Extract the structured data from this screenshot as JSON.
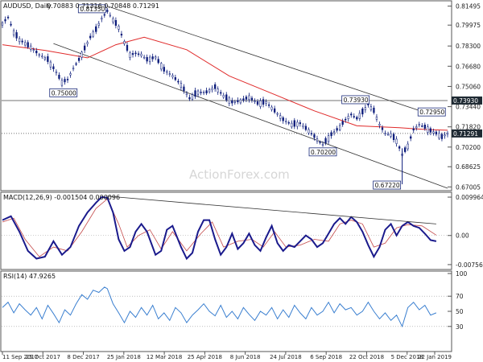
{
  "chart_data": [
    {
      "type": "candlestick",
      "panel": "price",
      "title": "AUDUSD, Daily",
      "ohlc_text": "0.70883 0.71316 0.70848 0.71291",
      "y_ticks": [
        0.81495,
        0.79975,
        0.783,
        0.7668,
        0.7506,
        0.7344,
        0.7182,
        0.702,
        0.68625,
        0.67005
      ],
      "ylim": [
        0.669,
        0.816
      ],
      "x_ticks": [
        "11 Sep 2017",
        "25 Oct 2017",
        "8 Dec 2017",
        "25 Jan 2018",
        "12 Mar 2018",
        "25 Apr 2018",
        "8 Jun 2018",
        "24 Jul 2018",
        "6 Sep 2018",
        "22 Oct 2018",
        "5 Dec 2018",
        "22 Jan 2019"
      ],
      "close_series": {
        "x_unit": "trading-day index, 0 = 11 Sep 2017",
        "points": [
          [
            0,
            0.801
          ],
          [
            4,
            0.806
          ],
          [
            8,
            0.794
          ],
          [
            12,
            0.788
          ],
          [
            16,
            0.785
          ],
          [
            20,
            0.782
          ],
          [
            26,
            0.776
          ],
          [
            32,
            0.772
          ],
          [
            38,
            0.762
          ],
          [
            42,
            0.754
          ],
          [
            46,
            0.756
          ],
          [
            50,
            0.765
          ],
          [
            54,
            0.772
          ],
          [
            58,
            0.781
          ],
          [
            62,
            0.79
          ],
          [
            66,
            0.796
          ],
          [
            70,
            0.805
          ],
          [
            74,
            0.811
          ],
          [
            78,
            0.804
          ],
          [
            82,
            0.798
          ],
          [
            86,
            0.786
          ],
          [
            90,
            0.776
          ],
          [
            94,
            0.777
          ],
          [
            98,
            0.776
          ],
          [
            102,
            0.772
          ],
          [
            108,
            0.774
          ],
          [
            114,
            0.764
          ],
          [
            120,
            0.759
          ],
          [
            126,
            0.752
          ],
          [
            132,
            0.741
          ],
          [
            138,
            0.746
          ],
          [
            144,
            0.746
          ],
          [
            150,
            0.75
          ],
          [
            156,
            0.743
          ],
          [
            162,
            0.738
          ],
          [
            168,
            0.739
          ],
          [
            174,
            0.742
          ],
          [
            180,
            0.737
          ],
          [
            186,
            0.738
          ],
          [
            192,
            0.731
          ],
          [
            198,
            0.724
          ],
          [
            204,
            0.72
          ],
          [
            210,
            0.721
          ],
          [
            214,
            0.717
          ],
          [
            218,
            0.713
          ],
          [
            222,
            0.708
          ],
          [
            226,
            0.704
          ],
          [
            232,
            0.712
          ],
          [
            238,
            0.718
          ],
          [
            242,
            0.724
          ],
          [
            246,
            0.728
          ],
          [
            250,
            0.725
          ],
          [
            254,
            0.73
          ],
          [
            258,
            0.736
          ],
          [
            262,
            0.731
          ],
          [
            266,
            0.72
          ],
          [
            270,
            0.713
          ],
          [
            274,
            0.712
          ],
          [
            278,
            0.707
          ],
          [
            282,
            0.696
          ],
          [
            286,
            0.703
          ],
          [
            290,
            0.716
          ],
          [
            294,
            0.72
          ],
          [
            298,
            0.718
          ],
          [
            302,
            0.715
          ],
          [
            306,
            0.713
          ],
          [
            310,
            0.71
          ],
          [
            314,
            0.7129
          ]
        ]
      },
      "moving_average_points": [
        [
          0,
          0.784
        ],
        [
          30,
          0.7795
        ],
        [
          60,
          0.7735
        ],
        [
          80,
          0.784
        ],
        [
          100,
          0.79
        ],
        [
          130,
          0.78
        ],
        [
          160,
          0.759
        ],
        [
          190,
          0.745
        ],
        [
          220,
          0.731
        ],
        [
          250,
          0.719
        ],
        [
          280,
          0.7175
        ],
        [
          300,
          0.716
        ],
        [
          314,
          0.7155
        ]
      ],
      "channel_upper": [
        [
          74,
          0.815
        ],
        [
          300,
          0.729
        ]
      ],
      "channel_lower": [
        [
          36,
          0.785
        ],
        [
          314,
          0.669
        ]
      ],
      "horizontal_levels": [
        {
          "value": 0.7393,
          "label": "0.73930",
          "style": "solid"
        },
        {
          "value": 0.71291,
          "label": "0.71291",
          "style": "dotted"
        }
      ],
      "annotations": [
        {
          "label": "0.81350",
          "x": 74,
          "y": 0.8135
        },
        {
          "label": "0.75000",
          "x": 43,
          "y": 0.75
        },
        {
          "label": "0.73930",
          "x": 261,
          "y": 0.7393
        },
        {
          "label": "0.72950",
          "x": 292,
          "y": 0.7295
        },
        {
          "label": "0.70200",
          "x": 226,
          "y": 0.702
        },
        {
          "label": "0.67220",
          "x": 282,
          "y": 0.6722
        }
      ],
      "colors": {
        "candle": "#0a1a7a",
        "moving_average": "#e02a2a",
        "trendline": "#333333",
        "level_label_bg": "#1f2a33"
      }
    },
    {
      "type": "line",
      "panel": "macd",
      "title": "MACD(12,26,9) -0.001504 0.000096",
      "y_ticks": [
        0.009964,
        0.0,
        -0.00756
      ],
      "y_tick_labels": [
        "0.009964",
        "0.00",
        "-0.00756"
      ],
      "ylim": [
        -0.0082,
        0.0106
      ],
      "macd_points": [
        [
          0,
          0.004
        ],
        [
          6,
          0.005
        ],
        [
          12,
          0.001
        ],
        [
          18,
          -0.004
        ],
        [
          24,
          -0.006
        ],
        [
          30,
          -0.0055
        ],
        [
          36,
          -0.0015
        ],
        [
          42,
          -0.005
        ],
        [
          48,
          -0.003
        ],
        [
          54,
          0.0025
        ],
        [
          60,
          0.006
        ],
        [
          66,
          0.0085
        ],
        [
          70,
          0.01
        ],
        [
          74,
          0.0098
        ],
        [
          78,
          0.006
        ],
        [
          82,
          -0.001
        ],
        [
          86,
          -0.004
        ],
        [
          90,
          -0.003
        ],
        [
          94,
          0.001
        ],
        [
          98,
          0.003
        ],
        [
          102,
          0.001
        ],
        [
          108,
          -0.005
        ],
        [
          112,
          -0.004
        ],
        [
          116,
          0.0015
        ],
        [
          120,
          0.0025
        ],
        [
          126,
          -0.003
        ],
        [
          130,
          -0.006
        ],
        [
          134,
          -0.0045
        ],
        [
          138,
          0.001
        ],
        [
          142,
          0.004
        ],
        [
          146,
          0.004
        ],
        [
          150,
          -0.001
        ],
        [
          154,
          -0.005
        ],
        [
          158,
          -0.003
        ],
        [
          162,
          0.0005
        ],
        [
          166,
          -0.0035
        ],
        [
          170,
          -0.002
        ],
        [
          174,
          0.0005
        ],
        [
          178,
          -0.0025
        ],
        [
          182,
          -0.004
        ],
        [
          186,
          -0.0005
        ],
        [
          190,
          0.0025
        ],
        [
          194,
          -0.002
        ],
        [
          198,
          -0.004
        ],
        [
          202,
          -0.0025
        ],
        [
          206,
          -0.003
        ],
        [
          210,
          -0.0015
        ],
        [
          214,
          0.0
        ],
        [
          218,
          -0.001
        ],
        [
          222,
          -0.003
        ],
        [
          226,
          -0.002
        ],
        [
          230,
          0.0005
        ],
        [
          234,
          0.003
        ],
        [
          238,
          0.0045
        ],
        [
          242,
          0.003
        ],
        [
          246,
          0.0048
        ],
        [
          250,
          0.0035
        ],
        [
          254,
          0.001
        ],
        [
          258,
          -0.0025
        ],
        [
          262,
          -0.0055
        ],
        [
          266,
          -0.003
        ],
        [
          270,
          0.0015
        ],
        [
          274,
          0.003
        ],
        [
          278,
          0.0
        ],
        [
          282,
          0.0025
        ],
        [
          286,
          0.0035
        ],
        [
          290,
          0.0025
        ],
        [
          294,
          0.002
        ],
        [
          298,
          0.0005
        ],
        [
          302,
          -0.0012
        ],
        [
          306,
          -0.0015
        ]
      ],
      "signal_points": [
        [
          0,
          0.0035
        ],
        [
          8,
          0.0045
        ],
        [
          16,
          -0.001
        ],
        [
          26,
          -0.0055
        ],
        [
          36,
          -0.003
        ],
        [
          46,
          -0.004
        ],
        [
          56,
          0.001
        ],
        [
          66,
          0.007
        ],
        [
          74,
          0.0095
        ],
        [
          82,
          0.003
        ],
        [
          88,
          -0.003
        ],
        [
          96,
          0.0
        ],
        [
          104,
          0.0015
        ],
        [
          112,
          -0.0035
        ],
        [
          120,
          0.001
        ],
        [
          130,
          -0.004
        ],
        [
          140,
          0.0005
        ],
        [
          148,
          0.0035
        ],
        [
          156,
          -0.003
        ],
        [
          166,
          -0.0015
        ],
        [
          176,
          -0.001
        ],
        [
          184,
          -0.003
        ],
        [
          192,
          0.001
        ],
        [
          200,
          -0.003
        ],
        [
          210,
          -0.0025
        ],
        [
          220,
          -0.001
        ],
        [
          230,
          -0.0015
        ],
        [
          238,
          0.003
        ],
        [
          246,
          0.004
        ],
        [
          254,
          0.003
        ],
        [
          262,
          -0.003
        ],
        [
          270,
          -0.002
        ],
        [
          278,
          0.002
        ],
        [
          286,
          0.0028
        ],
        [
          296,
          0.0025
        ],
        [
          306,
          0.0001
        ]
      ],
      "trendline": [
        [
          74,
          0.0102
        ],
        [
          306,
          0.003
        ]
      ],
      "colors": {
        "macd": "#1a1a8c",
        "signal": "#c44a4a",
        "trendline": "#333333"
      }
    },
    {
      "type": "line",
      "panel": "rsi",
      "title": "RSI(14) 47.9265",
      "y_ticks": [
        100,
        70,
        50,
        30
      ],
      "ylim": [
        0,
        100
      ],
      "levels": [
        70,
        30
      ],
      "rsi_points": [
        [
          0,
          55
        ],
        [
          4,
          62
        ],
        [
          8,
          48
        ],
        [
          12,
          60
        ],
        [
          16,
          52
        ],
        [
          20,
          45
        ],
        [
          24,
          55
        ],
        [
          28,
          40
        ],
        [
          32,
          58
        ],
        [
          36,
          47
        ],
        [
          40,
          35
        ],
        [
          44,
          52
        ],
        [
          48,
          45
        ],
        [
          52,
          60
        ],
        [
          56,
          72
        ],
        [
          60,
          66
        ],
        [
          64,
          78
        ],
        [
          68,
          75
        ],
        [
          72,
          82
        ],
        [
          74,
          80
        ],
        [
          78,
          60
        ],
        [
          82,
          48
        ],
        [
          86,
          35
        ],
        [
          90,
          50
        ],
        [
          94,
          42
        ],
        [
          98,
          55
        ],
        [
          102,
          45
        ],
        [
          106,
          58
        ],
        [
          110,
          40
        ],
        [
          114,
          48
        ],
        [
          118,
          38
        ],
        [
          122,
          55
        ],
        [
          126,
          48
        ],
        [
          130,
          35
        ],
        [
          134,
          45
        ],
        [
          138,
          52
        ],
        [
          142,
          60
        ],
        [
          146,
          50
        ],
        [
          150,
          44
        ],
        [
          154,
          58
        ],
        [
          158,
          42
        ],
        [
          162,
          50
        ],
        [
          166,
          40
        ],
        [
          170,
          55
        ],
        [
          174,
          46
        ],
        [
          178,
          38
        ],
        [
          182,
          50
        ],
        [
          186,
          45
        ],
        [
          190,
          55
        ],
        [
          194,
          40
        ],
        [
          198,
          52
        ],
        [
          202,
          42
        ],
        [
          206,
          58
        ],
        [
          210,
          48
        ],
        [
          214,
          40
        ],
        [
          218,
          55
        ],
        [
          222,
          45
        ],
        [
          226,
          50
        ],
        [
          230,
          62
        ],
        [
          234,
          48
        ],
        [
          238,
          60
        ],
        [
          242,
          52
        ],
        [
          246,
          55
        ],
        [
          250,
          45
        ],
        [
          254,
          50
        ],
        [
          258,
          62
        ],
        [
          262,
          50
        ],
        [
          266,
          40
        ],
        [
          270,
          48
        ],
        [
          274,
          38
        ],
        [
          278,
          45
        ],
        [
          282,
          30
        ],
        [
          286,
          55
        ],
        [
          290,
          62
        ],
        [
          294,
          52
        ],
        [
          298,
          58
        ],
        [
          302,
          45
        ],
        [
          306,
          48
        ]
      ],
      "colors": {
        "rsi": "#3a7fd0",
        "levels": "#999999"
      }
    }
  ],
  "watermark": "ActionForex.com"
}
